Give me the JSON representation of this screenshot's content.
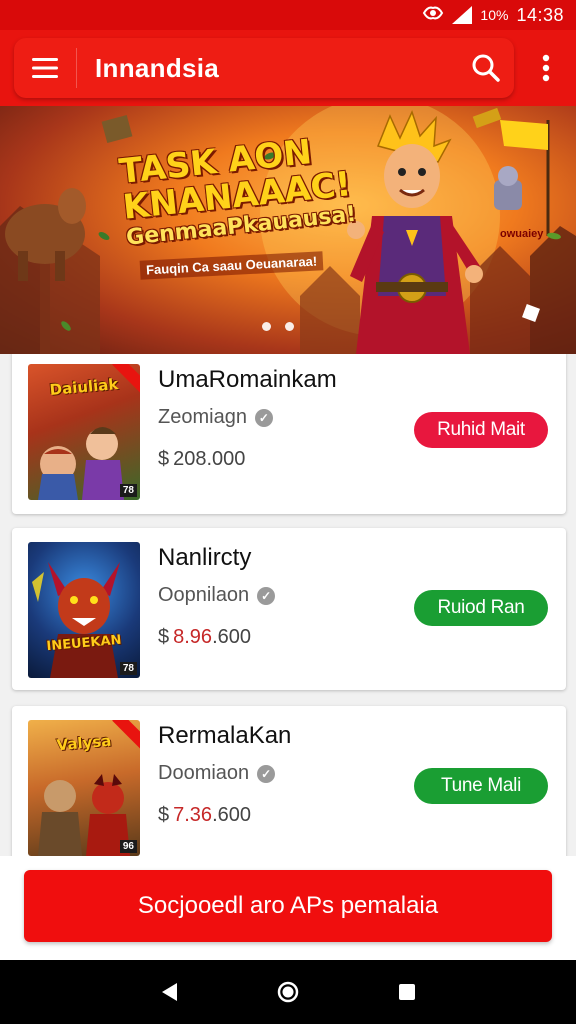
{
  "status_bar": {
    "battery": "10%",
    "time": "14:38"
  },
  "app_bar": {
    "title": "Innandsia",
    "menu_icon": "hamburger-menu-icon",
    "search_icon": "search-icon",
    "more_icon": "more-vert-icon"
  },
  "banner": {
    "title_line1": "TASK AON",
    "title_line2": "KNANAAAC!",
    "title_line3": "GenmaaPkauausa!",
    "subtitle": "Fauqin Ca saau Oeuanaraa!",
    "flag_text": "owuaiey",
    "page_count": 2
  },
  "games": [
    {
      "name": "UmaRomainkam",
      "subtitle": "Zeomiagn",
      "currency": "$",
      "price": "208.000",
      "button": "Ruhid Mait",
      "button_color": "#e8173e",
      "thumb_text": "Daiuliak",
      "thumb_badge": "78"
    },
    {
      "name": "Nanlircty",
      "subtitle": "Oopnilaon",
      "currency": "$",
      "price_red": "8.96",
      "price_rest": ".600",
      "button": "Ruiod Ran",
      "button_color": "#1a9e33",
      "thumb_text": "INEUEKAN",
      "thumb_badge": "78"
    },
    {
      "name": "RermalaKan",
      "subtitle": "Doomiaon",
      "currency": "$",
      "price_red": "7.36",
      "price_rest": ".600",
      "button": "Tune Mali",
      "button_color": "#1a9e33",
      "thumb_text": "Valysa",
      "thumb_badge": "96"
    }
  ],
  "cta": {
    "label": "Socjooedl aro APs pemalaia"
  },
  "nav_bar": {
    "back_icon": "back-triangle-icon",
    "home_icon": "home-circle-icon",
    "recents_icon": "recents-square-icon"
  },
  "colors": {
    "brand_red": "#e8140f",
    "cta_red": "#f00e0e",
    "button_red": "#e8173e",
    "button_green": "#1a9e33"
  }
}
